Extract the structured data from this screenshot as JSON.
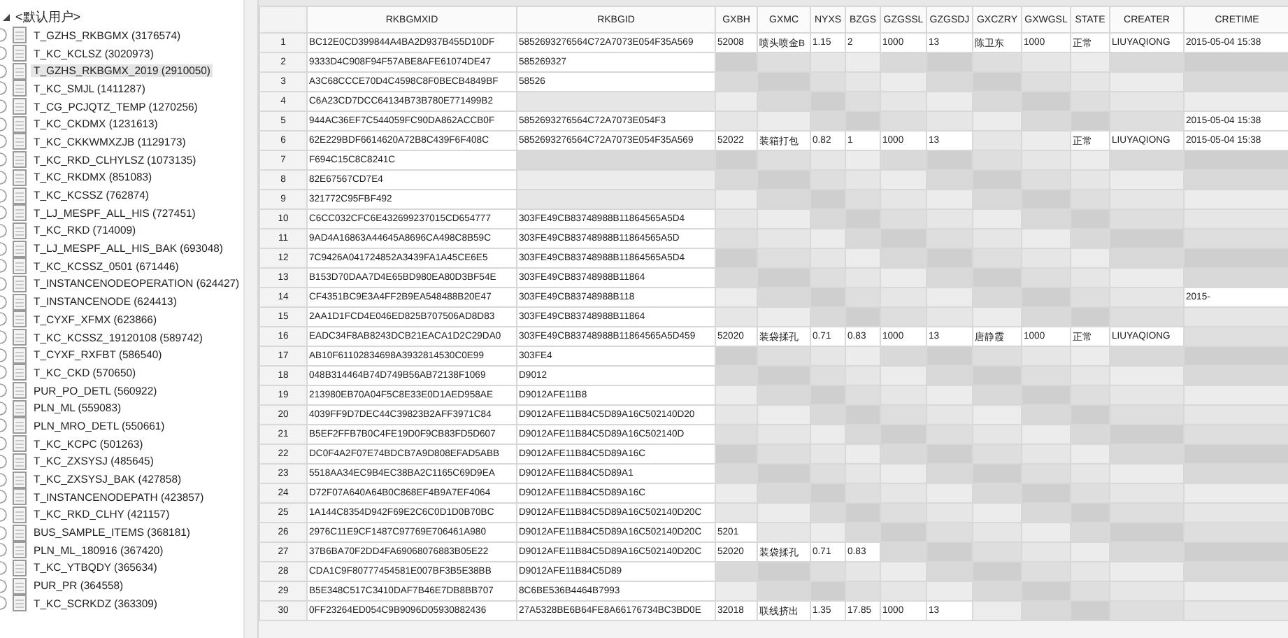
{
  "tree": {
    "root": {
      "label": "<默认用户>",
      "expanded": true
    },
    "items": [
      {
        "label": "T_GZHS_RKBGMX (3176574)",
        "selected": false
      },
      {
        "label": "T_KC_KCLSZ (3020973)",
        "selected": false
      },
      {
        "label": "T_GZHS_RKBGMX_2019 (2910050)",
        "selected": true
      },
      {
        "label": "T_KC_SMJL (1411287)",
        "selected": false
      },
      {
        "label": "T_CG_PCJQTZ_TEMP (1270256)",
        "selected": false
      },
      {
        "label": "T_KC_CKDMX (1231613)",
        "selected": false
      },
      {
        "label": "T_KC_CKKWMXZJB (1129173)",
        "selected": false
      },
      {
        "label": "T_KC_RKD_CLHYLSZ (1073135)",
        "selected": false
      },
      {
        "label": "T_KC_RKDMX (851083)",
        "selected": false
      },
      {
        "label": "T_KC_KCSSZ (762874)",
        "selected": false
      },
      {
        "label": "T_LJ_MESPF_ALL_HIS (727451)",
        "selected": false
      },
      {
        "label": "T_KC_RKD (714009)",
        "selected": false
      },
      {
        "label": "T_LJ_MESPF_ALL_HIS_BAK (693048)",
        "selected": false
      },
      {
        "label": "T_KC_KCSSZ_0501 (671446)",
        "selected": false
      },
      {
        "label": "T_INSTANCENODEOPERATION (624427)",
        "selected": false
      },
      {
        "label": "T_INSTANCENODE (624413)",
        "selected": false
      },
      {
        "label": "T_CYXF_XFMX (623866)",
        "selected": false
      },
      {
        "label": "T_KC_KCSSZ_19120108 (589742)",
        "selected": false
      },
      {
        "label": "T_CYXF_RXFBT (586540)",
        "selected": false
      },
      {
        "label": "T_KC_CKD (570650)",
        "selected": false
      },
      {
        "label": "PUR_PO_DETL (560922)",
        "selected": false
      },
      {
        "label": "PLN_ML (559083)",
        "selected": false
      },
      {
        "label": "PLN_MRO_DETL (550661)",
        "selected": false
      },
      {
        "label": "T_KC_KCPC (501263)",
        "selected": false
      },
      {
        "label": "T_KC_ZXSYSJ (485645)",
        "selected": false
      },
      {
        "label": "T_KC_ZXSYSJ_BAK (427858)",
        "selected": false
      },
      {
        "label": "T_INSTANCENODEPATH (423857)",
        "selected": false
      },
      {
        "label": "T_KC_RKD_CLHY (421157)",
        "selected": false
      },
      {
        "label": "BUS_SAMPLE_ITEMS (368181)",
        "selected": false
      },
      {
        "label": "PLN_ML_180916 (367420)",
        "selected": false
      },
      {
        "label": "T_KC_YTBQDY (365634)",
        "selected": false
      },
      {
        "label": "PUR_PR (364558)",
        "selected": false
      },
      {
        "label": "T_KC_SCRKDZ (363309)",
        "selected": false
      }
    ]
  },
  "table": {
    "columns": [
      "RKBGMXID",
      "RKBGID",
      "GXBH",
      "GXMC",
      "NYXS",
      "BZGS",
      "GZGSSL",
      "GZGSDJ",
      "GXCZRY",
      "GXWGSL",
      "STATE",
      "CREATER",
      "CRETIME"
    ],
    "rows": [
      {
        "no": "1",
        "cells": [
          "BC12E0CD399844A4BA2D937B455D10DF",
          "5852693276564C72A7073E054F35A569",
          "52008",
          "喷头喷金B",
          "1.15",
          "2",
          "1000",
          "13",
          "陈卫东",
          "1000",
          "正常",
          "LIUYAQIONG",
          "2015-05-04 15:38"
        ]
      },
      {
        "no": "2",
        "cells": [
          "9333D4C908F94F57ABE8AFE61074DE47",
          "585269327",
          null,
          null,
          null,
          null,
          null,
          null,
          null,
          null,
          null,
          null,
          null
        ]
      },
      {
        "no": "3",
        "cells": [
          "A3C68CCCE70D4C4598C8F0BECB4849BF",
          "58526",
          null,
          null,
          null,
          null,
          null,
          null,
          null,
          null,
          null,
          null,
          null
        ]
      },
      {
        "no": "4",
        "cells": [
          "C6A23CD7DCC64134B73B780E771499B2",
          null,
          null,
          null,
          null,
          null,
          null,
          null,
          null,
          null,
          null,
          null,
          null
        ]
      },
      {
        "no": "5",
        "cells": [
          "944AC36EF7C544059FC90DA862ACCB0F",
          "5852693276564C72A7073E054F3",
          null,
          null,
          null,
          null,
          null,
          null,
          null,
          null,
          null,
          null,
          "2015-05-04 15:38"
        ]
      },
      {
        "no": "6",
        "cells": [
          "62E229BDF6614620A72B8C439F6F408C",
          "5852693276564C72A7073E054F35A569",
          "52022",
          "装箱打包",
          "0.82",
          "1",
          "1000",
          "13",
          null,
          null,
          "正常",
          "LIUYAQIONG",
          "2015-05-04 15:38"
        ]
      },
      {
        "no": "7",
        "cells": [
          "F694C15C8C8241C",
          null,
          null,
          null,
          null,
          null,
          null,
          null,
          null,
          null,
          null,
          null,
          null
        ]
      },
      {
        "no": "8",
        "cells": [
          "82E67567CD7E4",
          null,
          null,
          null,
          null,
          null,
          null,
          null,
          null,
          null,
          null,
          null,
          null
        ]
      },
      {
        "no": "9",
        "cells": [
          "321772C95FBF492",
          null,
          null,
          null,
          null,
          null,
          null,
          null,
          null,
          null,
          null,
          null,
          null
        ]
      },
      {
        "no": "10",
        "cells": [
          "C6CC032CFC6E432699237015CD654777",
          "303FE49CB83748988B11864565A5D4",
          null,
          null,
          null,
          null,
          null,
          null,
          null,
          null,
          null,
          null,
          null
        ]
      },
      {
        "no": "11",
        "cells": [
          "9AD4A16863A44645A8696CA498C8B59C",
          "303FE49CB83748988B11864565A5D",
          null,
          null,
          null,
          null,
          null,
          null,
          null,
          null,
          null,
          null,
          null
        ]
      },
      {
        "no": "12",
        "cells": [
          "7C9426A041724852A3439FA1A45CE6E5",
          "303FE49CB83748988B11864565A5D4",
          null,
          null,
          null,
          null,
          null,
          null,
          null,
          null,
          null,
          null,
          null
        ]
      },
      {
        "no": "13",
        "cells": [
          "B153D70DAA7D4E65BD980EA80D3BF54E",
          "303FE49CB83748988B11864",
          null,
          null,
          null,
          null,
          null,
          null,
          null,
          null,
          null,
          null,
          null
        ]
      },
      {
        "no": "14",
        "cells": [
          "CF4351BC9E3A4FF2B9EA548488B20E47",
          "303FE49CB83748988B118",
          null,
          null,
          null,
          null,
          null,
          null,
          null,
          null,
          null,
          null,
          "2015-"
        ]
      },
      {
        "no": "15",
        "cells": [
          "2AA1D1FCD4E046ED825B707506AD8D83",
          "303FE49CB83748988B11864",
          null,
          null,
          null,
          null,
          null,
          null,
          null,
          null,
          null,
          null,
          null
        ]
      },
      {
        "no": "16",
        "cells": [
          "EADC34F8AB8243DCB21EACA1D2C29DA0",
          "303FE49CB83748988B11864565A5D459",
          "52020",
          "装袋揉孔",
          "0.71",
          "0.83",
          "1000",
          "13",
          "唐静霞",
          "1000",
          "正常",
          "LIUYAQIONG",
          null
        ]
      },
      {
        "no": "17",
        "cells": [
          "AB10F61102834698A3932814530C0E99",
          "303FE4",
          null,
          null,
          null,
          null,
          null,
          null,
          null,
          null,
          null,
          null,
          null
        ]
      },
      {
        "no": "18",
        "cells": [
          "048B314464B74D749B56AB72138F1069",
          "D9012",
          null,
          null,
          null,
          null,
          null,
          null,
          null,
          null,
          null,
          null,
          null
        ]
      },
      {
        "no": "19",
        "cells": [
          "213980EB70A04F5C8E33E0D1AED958AE",
          "D9012AFE11B8",
          null,
          null,
          null,
          null,
          null,
          null,
          null,
          null,
          null,
          null,
          null
        ]
      },
      {
        "no": "20",
        "cells": [
          "4039FF9D7DEC44C39823B2AFF3971C84",
          "D9012AFE11B84C5D89A16C502140D20",
          null,
          null,
          null,
          null,
          null,
          null,
          null,
          null,
          null,
          null,
          null
        ]
      },
      {
        "no": "21",
        "cells": [
          "B5EF2FFB7B0C4FE19D0F9CB83FD5D607",
          "D9012AFE11B84C5D89A16C502140D",
          null,
          null,
          null,
          null,
          null,
          null,
          null,
          null,
          null,
          null,
          null
        ]
      },
      {
        "no": "22",
        "cells": [
          "DC0F4A2F07E74BDCB7A9D808EFAD5ABB",
          "D9012AFE11B84C5D89A16C",
          null,
          null,
          null,
          null,
          null,
          null,
          null,
          null,
          null,
          null,
          null
        ]
      },
      {
        "no": "23",
        "cells": [
          "5518AA34EC9B4EC38BA2C1165C69D9EA",
          "D9012AFE11B84C5D89A1",
          null,
          null,
          null,
          null,
          null,
          null,
          null,
          null,
          null,
          null,
          null
        ]
      },
      {
        "no": "24",
        "cells": [
          "D72F07A640A64B0C868EF4B9A7EF4064",
          "D9012AFE11B84C5D89A16C",
          null,
          null,
          null,
          null,
          null,
          null,
          null,
          null,
          null,
          null,
          null
        ]
      },
      {
        "no": "25",
        "cells": [
          "1A144C8354D942F69E2C6C0D1D0B70BC",
          "D9012AFE11B84C5D89A16C502140D20C",
          null,
          null,
          null,
          null,
          null,
          null,
          null,
          null,
          null,
          null,
          null
        ]
      },
      {
        "no": "26",
        "cells": [
          "2976C11E9CF1487C97769E706461A980",
          "D9012AFE11B84C5D89A16C502140D20C",
          "5201",
          null,
          null,
          null,
          null,
          null,
          null,
          null,
          null,
          null,
          null
        ]
      },
      {
        "no": "27",
        "cells": [
          "37B6BA70F2DD4FA69068076883B05E22",
          "D9012AFE11B84C5D89A16C502140D20C",
          "52020",
          "装袋揉孔",
          "0.71",
          "0.83",
          null,
          null,
          null,
          null,
          null,
          null,
          null
        ]
      },
      {
        "no": "28",
        "cells": [
          "CDA1C9F80777454581E007BF3B5E38BB",
          "D9012AFE11B84C5D89",
          null,
          null,
          null,
          null,
          null,
          null,
          null,
          null,
          null,
          null,
          null
        ]
      },
      {
        "no": "29",
        "cells": [
          "B5E348C517C3410DAF7B46E7DB8BB707",
          "8C6BE536B4464B7993",
          null,
          null,
          null,
          null,
          null,
          null,
          null,
          null,
          null,
          null,
          null
        ]
      },
      {
        "no": "30",
        "cells": [
          "0FF23264ED054C9B9096D05930882436",
          "27A5328BE6B64FE8A66176734BC3BD0E",
          "32018",
          "联线挤出",
          "1.35",
          "17.85",
          "1000",
          "13",
          null,
          null,
          null,
          null,
          null
        ]
      }
    ]
  }
}
